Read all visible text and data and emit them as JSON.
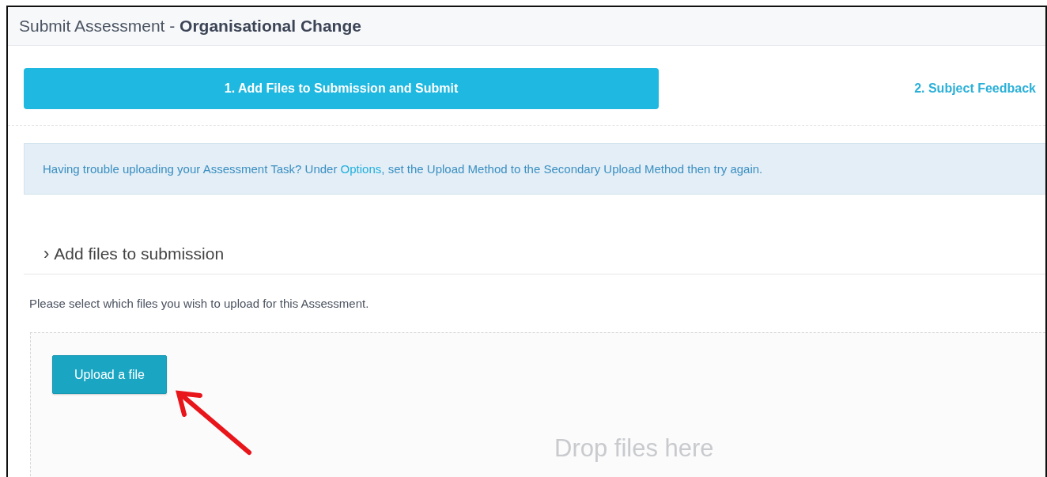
{
  "header": {
    "title": "Submit Assessment - **Organisational Change**"
  },
  "steps": [
    {
      "label": "1. Add Files to Submission and Submit",
      "selected": true
    },
    {
      "label": "2. Subject Feedback",
      "selected": false
    }
  ],
  "alert": {
    "text_before": "Having trouble uploading your Assessment Task? Under",
    "link": "Options",
    "text_after": ", set the Upload Method to the Secondary Upload Method then try again."
  },
  "section": {
    "chevron": "›",
    "title": "Add files to submission"
  },
  "instructions": "Please select which files you wish to upload for this Assessment.",
  "dropzone": {
    "button": "Upload a file",
    "hint": "Drop files here"
  }
}
